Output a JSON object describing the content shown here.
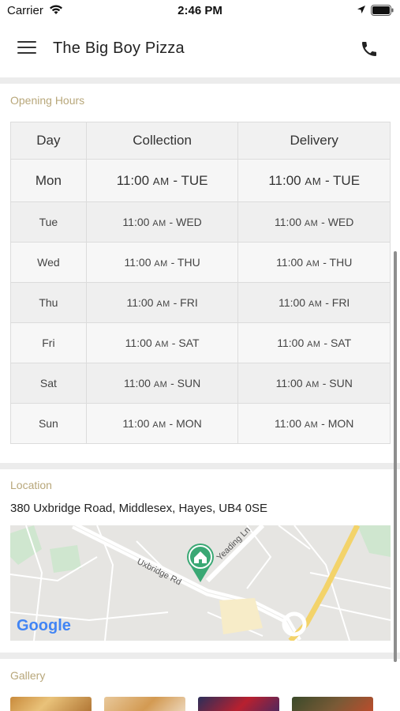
{
  "status_bar": {
    "carrier": "Carrier",
    "time": "2:46 PM",
    "icons": [
      "wifi-icon",
      "location-arrow-icon",
      "battery-icon"
    ]
  },
  "header": {
    "title": "The Big Boy Pizza",
    "menu_icon": "hamburger-menu-icon",
    "call_icon": "phone-icon"
  },
  "opening_hours": {
    "section_label": "Opening Hours",
    "columns": [
      "Day",
      "Collection",
      "Delivery"
    ],
    "rows": [
      {
        "day": "Mon",
        "collection_time": "11:00",
        "collection_ampm": "AM",
        "collection_until": " - TUE",
        "delivery_time": "11:00",
        "delivery_ampm": "AM",
        "delivery_until": " - TUE"
      },
      {
        "day": "Tue",
        "collection_time": "11:00",
        "collection_ampm": "AM",
        "collection_until": " - WED",
        "delivery_time": "11:00",
        "delivery_ampm": "AM",
        "delivery_until": " - WED"
      },
      {
        "day": "Wed",
        "collection_time": "11:00",
        "collection_ampm": "AM",
        "collection_until": " - THU",
        "delivery_time": "11:00",
        "delivery_ampm": "AM",
        "delivery_until": " - THU"
      },
      {
        "day": "Thu",
        "collection_time": "11:00",
        "collection_ampm": "AM",
        "collection_until": " - FRI",
        "delivery_time": "11:00",
        "delivery_ampm": "AM",
        "delivery_until": " - FRI"
      },
      {
        "day": "Fri",
        "collection_time": "11:00",
        "collection_ampm": "AM",
        "collection_until": " - SAT",
        "delivery_time": "11:00",
        "delivery_ampm": "AM",
        "delivery_until": " - SAT"
      },
      {
        "day": "Sat",
        "collection_time": "11:00",
        "collection_ampm": "AM",
        "collection_until": " - SUN",
        "delivery_time": "11:00",
        "delivery_ampm": "AM",
        "delivery_until": " - SUN"
      },
      {
        "day": "Sun",
        "collection_time": "11:00",
        "collection_ampm": "AM",
        "collection_until": " - MON",
        "delivery_time": "11:00",
        "delivery_ampm": "AM",
        "delivery_until": " - MON"
      }
    ]
  },
  "location": {
    "section_label": "Location",
    "address": "380 Uxbridge Road, Middlesex, Hayes, UB4 0SE",
    "map": {
      "street_labels": [
        "Uxbridge Rd",
        "Yeading Ln"
      ],
      "logo_text": "Google",
      "pin_icon": "home-pin-icon"
    }
  },
  "gallery": {
    "section_label": "Gallery",
    "thumbnails": 4
  },
  "colors": {
    "section_label": "#b8a77a",
    "pin_green": "#3aa874",
    "divider": "#ececec"
  }
}
